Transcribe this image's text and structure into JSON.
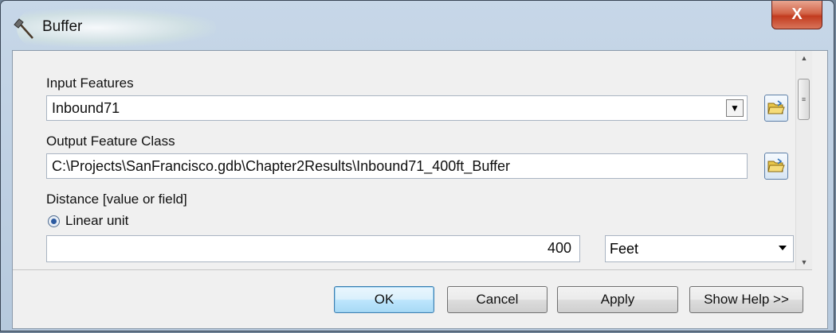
{
  "window": {
    "title": "Buffer",
    "close_label": "X"
  },
  "input_features": {
    "label": "Input Features",
    "value": "Inbound71"
  },
  "output_feature_class": {
    "label": "Output Feature Class",
    "value": "C:\\Projects\\SanFrancisco.gdb\\Chapter2Results\\Inbound71_400ft_Buffer"
  },
  "distance": {
    "label": "Distance [value or field]",
    "radio_label": "Linear unit",
    "value": "400",
    "unit": "Feet"
  },
  "buttons": {
    "ok": "OK",
    "cancel": "Cancel",
    "apply": "Apply",
    "show_help": "Show Help >>"
  },
  "icons": {
    "title": "hammer-icon",
    "browse": "folder-open-icon"
  }
}
